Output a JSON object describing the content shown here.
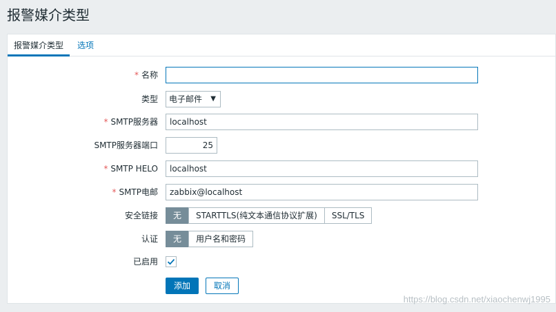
{
  "page": {
    "title": "报警媒介类型"
  },
  "tabs": [
    {
      "label": "报警媒介类型"
    },
    {
      "label": "选项"
    }
  ],
  "form": {
    "name": {
      "label": "名称",
      "value": ""
    },
    "type": {
      "label": "类型",
      "value": "电子邮件"
    },
    "smtp_server": {
      "label": "SMTP服务器",
      "value": "localhost"
    },
    "smtp_port": {
      "label": "SMTP服务器端口",
      "value": "25"
    },
    "smtp_helo": {
      "label": "SMTP HELO",
      "value": "localhost"
    },
    "smtp_email": {
      "label": "SMTP电邮",
      "value": "zabbix@localhost"
    },
    "security": {
      "label": "安全链接",
      "options": [
        "无",
        "STARTTLS(纯文本通信协议扩展)",
        "SSL/TLS"
      ],
      "selected": "无"
    },
    "auth": {
      "label": "认证",
      "options": [
        "无",
        "用户名和密码"
      ],
      "selected": "无"
    },
    "enabled": {
      "label": "已启用",
      "checked": true
    }
  },
  "buttons": {
    "add": "添加",
    "cancel": "取消"
  },
  "required_mark": "*",
  "watermark": "https://blog.csdn.net/xiaochenwj1995",
  "colors": {
    "accent": "#0275b8",
    "required": "#e45959",
    "segment_on": "#768d99"
  }
}
